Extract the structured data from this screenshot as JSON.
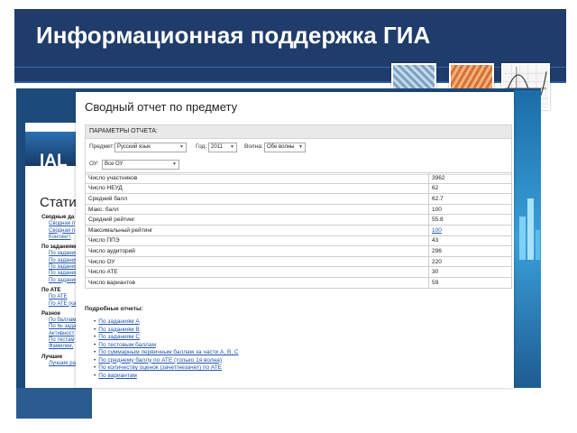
{
  "slide": {
    "title": "Информационная поддержка ГИА",
    "colors": {
      "header": "#1f3c6b",
      "link": "#2255aa",
      "background_screenshot": "#1c4a7a"
    }
  },
  "background_page": {
    "logo": "IAL",
    "heading": "Статист",
    "menu": [
      {
        "type": "heading",
        "text": "Сводные да"
      },
      {
        "type": "link",
        "text": "Сводная п"
      },
      {
        "type": "link",
        "text": "Сводная п"
      },
      {
        "type": "link",
        "text": "Контингт"
      },
      {
        "type": "heading",
        "text": "По заданиям"
      },
      {
        "type": "link",
        "text": "По задания"
      },
      {
        "type": "link",
        "text": "По задания"
      },
      {
        "type": "link",
        "text": "По задания"
      },
      {
        "type": "link",
        "text": "По задания"
      },
      {
        "type": "link",
        "text": "По задания"
      },
      {
        "type": "heading",
        "text": "По АТЕ"
      },
      {
        "type": "link",
        "text": "По АТЕ"
      },
      {
        "type": "link",
        "text": "По АТЕ (ка"
      },
      {
        "type": "heading",
        "text": "Разное"
      },
      {
        "type": "link",
        "text": "По баллам"
      },
      {
        "type": "link",
        "text": "По № задан"
      },
      {
        "type": "link",
        "text": "Активност"
      },
      {
        "type": "link",
        "text": "По тестам"
      },
      {
        "type": "link",
        "text": "Фамилии,"
      },
      {
        "type": "heading",
        "text": "Лучшие"
      },
      {
        "type": "link",
        "text": "Лучшие ра"
      }
    ]
  },
  "report": {
    "title": "Сводный отчет по предмету",
    "params_title": "ПАРАМЕТРЫ ОТЧЕТА:",
    "filters": {
      "subject_label": "Предмет:",
      "subject_value": "Русский язык",
      "year_label": "Год:",
      "year_value": "2011",
      "wave_label": "Волна:",
      "wave_value": "Обе волны",
      "school_label": "ОУ:",
      "school_value": "Все ОУ"
    },
    "stats": [
      {
        "label": "Число участников",
        "value": "3962",
        "link": false
      },
      {
        "label": "Число НЕУД",
        "value": "62",
        "link": false
      },
      {
        "label": "Средний балл",
        "value": "62.7",
        "link": false
      },
      {
        "label": "Макс. балл",
        "value": "100",
        "link": false
      },
      {
        "label": "Средний рейтинг",
        "value": "55.8",
        "link": false
      },
      {
        "label": "Максимальный рейтинг",
        "value": "100",
        "link": true
      },
      {
        "label": "Число ППЭ",
        "value": "43",
        "link": false
      },
      {
        "label": "Число аудиторий",
        "value": "296",
        "link": false
      },
      {
        "label": "Число ОУ",
        "value": "220",
        "link": false
      },
      {
        "label": "Число АТЕ",
        "value": "30",
        "link": false
      },
      {
        "label": "Число вариантов",
        "value": "59",
        "link": false
      }
    ],
    "details_title": "Подробные отчеты:",
    "details": [
      "По заданиям А",
      "По заданиям В",
      "По заданиям С",
      "По тестовым баллам",
      "По суммарным первичным баллам за части А, В, С",
      "По среднему баллу по АТЕ (только 1я волна)",
      "По количеству оценок (зачет/незачет) по АТЕ",
      "По вариантам"
    ]
  }
}
